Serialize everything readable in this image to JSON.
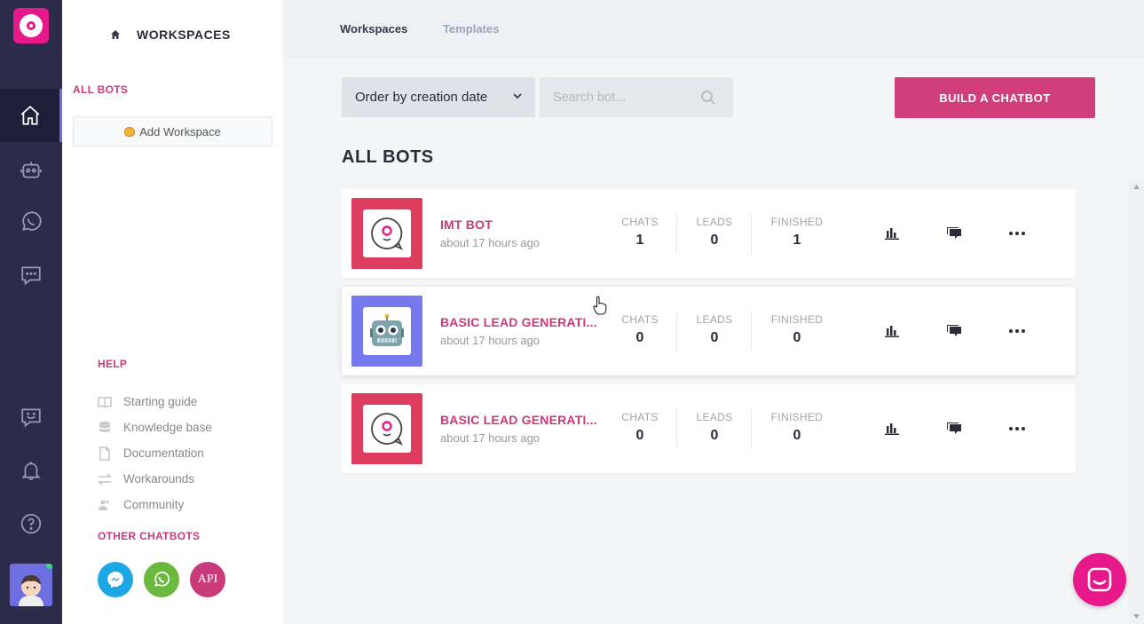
{
  "topbar": {
    "tabs": [
      {
        "label": "Workspaces",
        "active": true
      },
      {
        "label": "Templates",
        "active": false
      }
    ]
  },
  "sidebar": {
    "title": "WORKSPACES",
    "all_bots_label": "ALL BOTS",
    "add_workspace_label": "Add Workspace",
    "help_label": "HELP",
    "help_items": [
      {
        "label": "Starting guide",
        "icon": "book-icon"
      },
      {
        "label": "Knowledge base",
        "icon": "database-icon"
      },
      {
        "label": "Documentation",
        "icon": "document-icon"
      },
      {
        "label": "Workarounds",
        "icon": "swap-icon"
      },
      {
        "label": "Community",
        "icon": "users-icon"
      }
    ],
    "other_chatbots_label": "OTHER CHATBOTS",
    "other_chatbots": [
      {
        "name": "messenger",
        "color": "#1ea7e6"
      },
      {
        "name": "whatsapp",
        "color": "#6bb83f"
      },
      {
        "name": "api",
        "label": "API",
        "color": "#c93a78"
      }
    ]
  },
  "rail": {
    "items": [
      "home-icon",
      "robot-icon",
      "whatsapp-icon",
      "chat-bubble-icon",
      "feedback-icon",
      "bell-icon",
      "help-icon"
    ]
  },
  "toolbar": {
    "order_label": "Order by creation date",
    "search_placeholder": "Search bot...",
    "build_label": "BUILD A CHATBOT"
  },
  "main": {
    "section_title": "ALL BOTS",
    "stat_labels": {
      "chats": "CHATS",
      "leads": "LEADS",
      "finished": "FINISHED"
    },
    "bots": [
      {
        "name": "IMT BOT",
        "time": "about 17 hours ago",
        "chats": "1",
        "leads": "0",
        "finished": "1",
        "thumb_color": "#dd3e60",
        "thumb_icon": "imt-logo-icon"
      },
      {
        "name": "BASIC LEAD GENERATI...",
        "time": "about 17 hours ago",
        "chats": "0",
        "leads": "0",
        "finished": "0",
        "thumb_color": "#7678ee",
        "thumb_icon": "robot-face-icon"
      },
      {
        "name": "BASIC LEAD GENERATI...",
        "time": "about 17 hours ago",
        "chats": "0",
        "leads": "0",
        "finished": "0",
        "thumb_color": "#dd3e60",
        "thumb_icon": "imt-logo-icon"
      }
    ]
  },
  "colors": {
    "accent": "#c93a78",
    "brand": "#e6188a",
    "rail_bg": "#2c2b4a"
  }
}
